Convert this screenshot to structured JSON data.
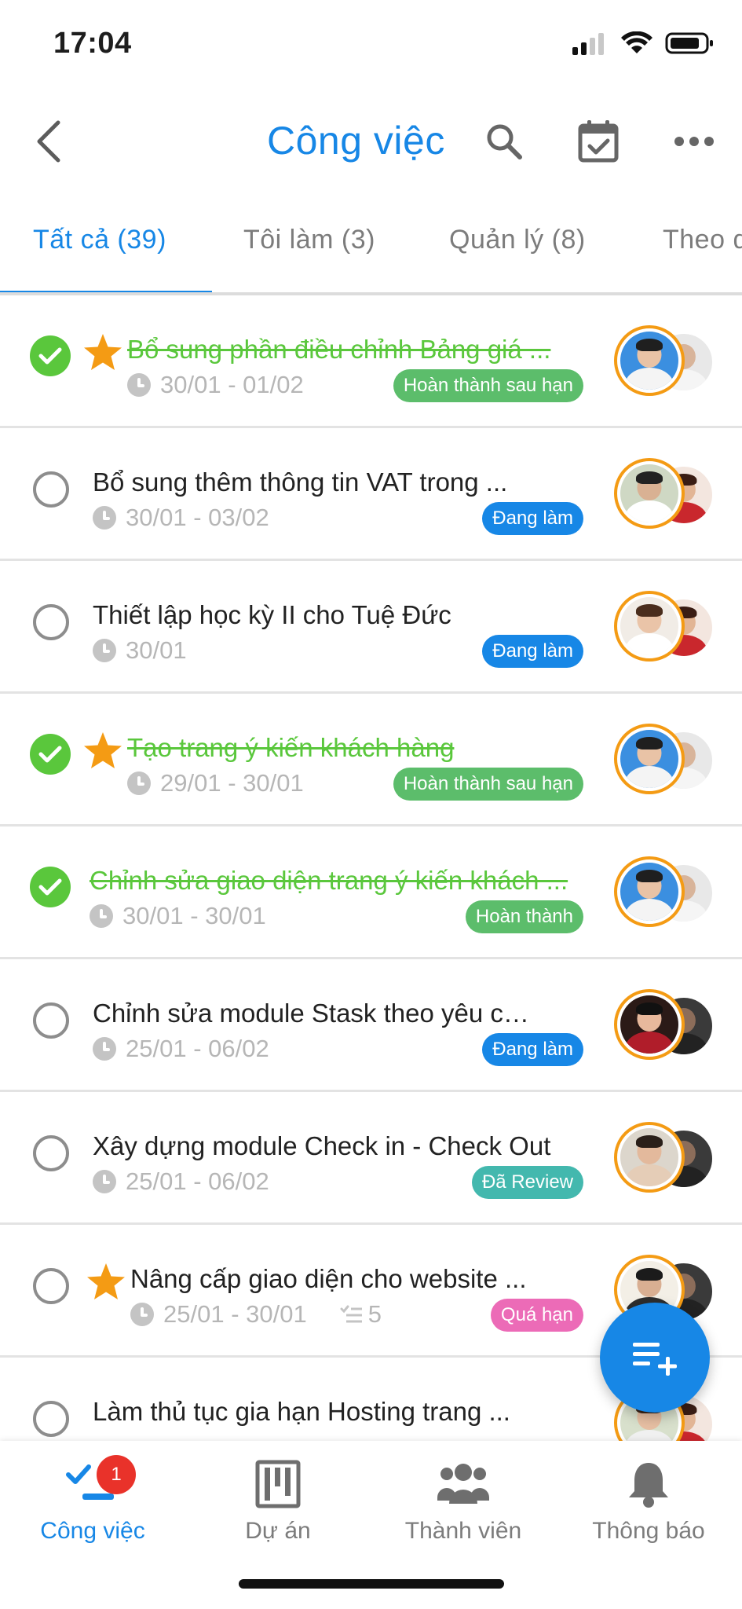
{
  "status_bar": {
    "time": "17:04"
  },
  "header": {
    "title": "Công việc"
  },
  "tabs": [
    {
      "label": "Tất cả (39)",
      "active": true
    },
    {
      "label": "Tôi làm (3)",
      "active": false
    },
    {
      "label": "Quản lý (8)",
      "active": false
    },
    {
      "label": "Theo dõi",
      "active": false
    }
  ],
  "tasks": [
    {
      "title": "Bổ sung phần điều chỉnh Bảng giá ...",
      "date": "30/01 - 01/02",
      "status": "Hoàn thành sau hạn",
      "done": true,
      "starred": true
    },
    {
      "title": "Bổ sung thêm thông tin VAT trong ...",
      "date": "30/01 - 03/02",
      "status": "Đang làm",
      "done": false,
      "starred": false
    },
    {
      "title": "Thiết lập học kỳ II cho Tuệ Đức",
      "date": "30/01",
      "status": "Đang làm",
      "done": false,
      "starred": false
    },
    {
      "title": "Tạo trang ý kiến khách hàng",
      "date": "29/01 - 30/01",
      "status": "Hoàn thành sau hạn",
      "done": true,
      "starred": true
    },
    {
      "title": "Chỉnh sửa giao diện trang ý kiến khách ...",
      "date": "30/01 - 30/01",
      "status": "Hoàn thành",
      "done": true,
      "starred": false
    },
    {
      "title": "Chỉnh sửa module Stask theo yêu cầu ...",
      "date": "25/01 - 06/02",
      "status": "Đang làm",
      "done": false,
      "starred": false
    },
    {
      "title": "Xây dựng module Check in - Check Out",
      "date": "25/01 - 06/02",
      "status": "Đã Review",
      "done": false,
      "starred": false
    },
    {
      "title": "Nâng cấp giao diện cho website ...",
      "date": "25/01 - 30/01",
      "subtasks": "5",
      "status": "Quá hạn",
      "done": false,
      "starred": true
    },
    {
      "title": "Làm thủ tục gia hạn Hosting trang ...",
      "date": "",
      "status": "",
      "done": false,
      "starred": false
    }
  ],
  "colors": {
    "accent": "#1787e6",
    "done_green": "#5ac73c",
    "badge_green": "#5cbd6b",
    "badge_blue": "#1787e6",
    "badge_teal": "#43b8ae",
    "badge_pink": "#ec6bb7",
    "avatar_ring": "#f49b14"
  },
  "bottom_nav": [
    {
      "label": "Công việc",
      "icon": "tasks-icon",
      "active": true,
      "badge": "1"
    },
    {
      "label": "Dự án",
      "icon": "kanban-icon",
      "active": false
    },
    {
      "label": "Thành viên",
      "icon": "members-icon",
      "active": false
    },
    {
      "label": "Thông báo",
      "icon": "bell-icon",
      "active": false
    }
  ]
}
